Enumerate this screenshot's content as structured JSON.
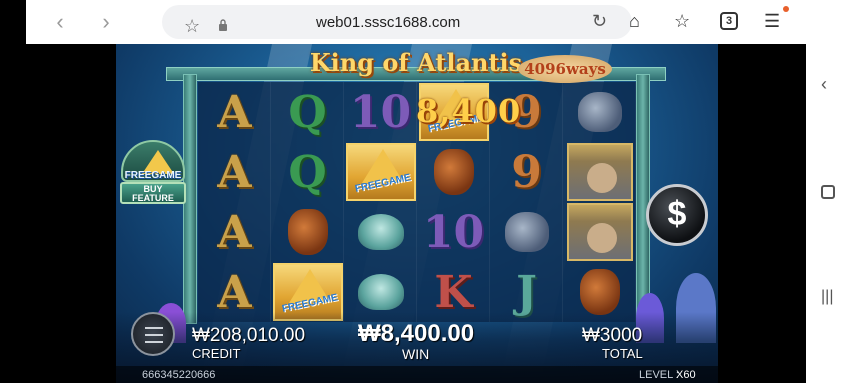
{
  "browser": {
    "url": "web01.sssc1688.com",
    "tabs_count": "3"
  },
  "game": {
    "title": "King of Atlantis",
    "ways": "4096ways",
    "win_amount_overlay": "8,400",
    "buy_feature": {
      "top": "FREEGAME",
      "button": "BUY FEATURE"
    },
    "reels": [
      [
        "A",
        "A",
        "A",
        "A"
      ],
      [
        "Q",
        "Q",
        "urn",
        "FREEGAME"
      ],
      [
        "10",
        "FREEGAME",
        "shell",
        "shell"
      ],
      [
        "FREEGAME",
        "urn",
        "10",
        "K"
      ],
      [
        "9",
        "9",
        "sack",
        "J"
      ],
      [
        "sack",
        "king",
        "king",
        "urn"
      ]
    ],
    "credit_value": "₩208,010.00",
    "credit_label": "CREDIT",
    "win_value": "₩8,400.00",
    "win_label": "WIN",
    "total_value": "₩3000",
    "total_label": "TOTAL",
    "session_id": "666345220666",
    "level_label": "LEVEL :",
    "level_value": "X60",
    "spin_icon": "dollar-icon"
  }
}
